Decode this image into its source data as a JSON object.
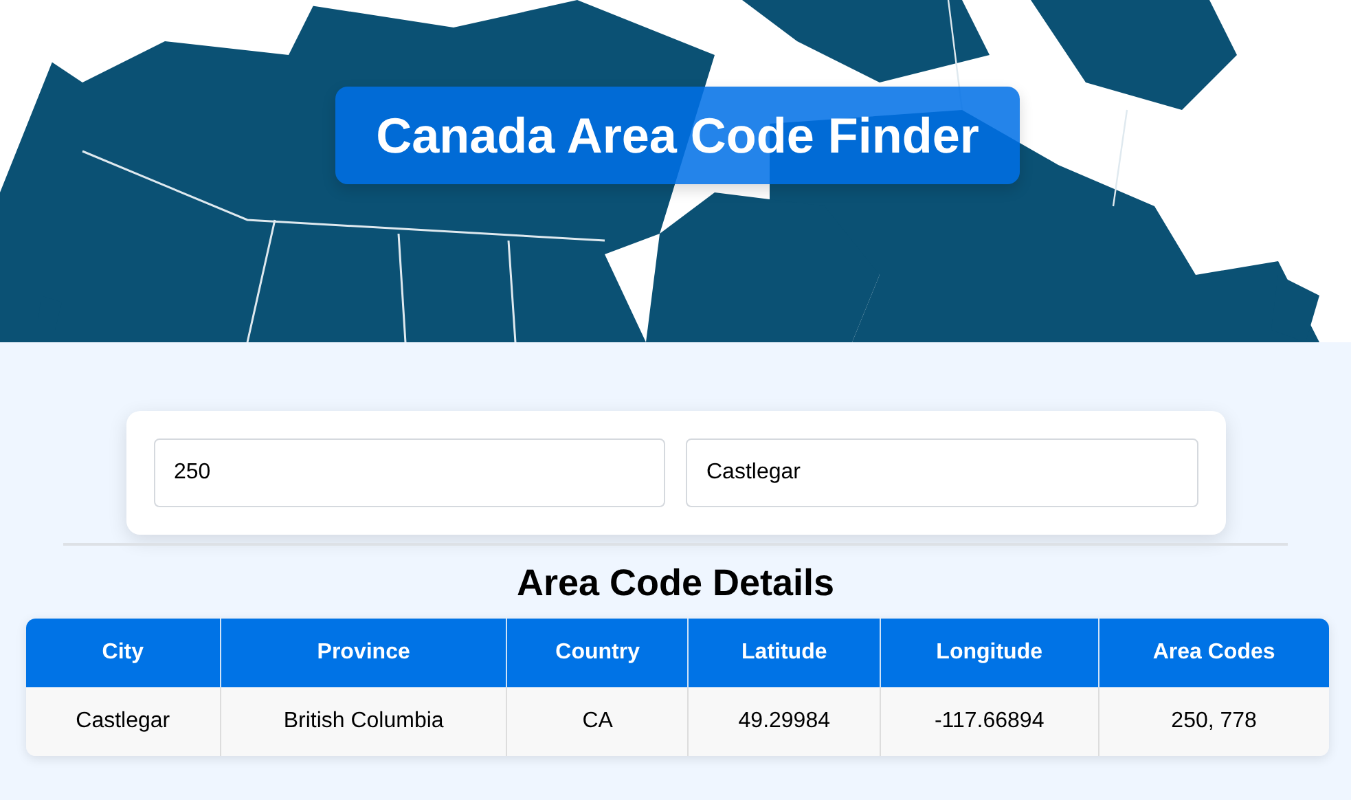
{
  "header": {
    "title": "Canada Area Code Finder"
  },
  "search": {
    "area_code": "250",
    "city": "Castlegar"
  },
  "details": {
    "title": "Area Code Details",
    "columns": [
      "City",
      "Province",
      "Country",
      "Latitude",
      "Longitude",
      "Area Codes"
    ],
    "rows": [
      [
        "Castlegar",
        "British Columbia",
        "CA",
        "49.29984",
        "-117.66894",
        "250, 778"
      ]
    ]
  }
}
